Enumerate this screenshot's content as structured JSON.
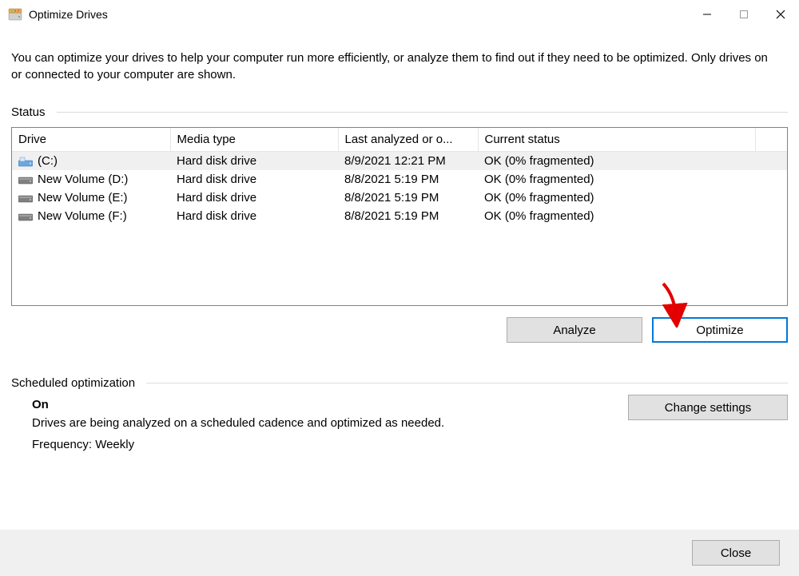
{
  "window": {
    "title": "Optimize Drives"
  },
  "description": "You can optimize your drives to help your computer run more efficiently, or analyze them to find out if they need to be optimized. Only drives on or connected to your computer are shown.",
  "status_label": "Status",
  "columns": {
    "drive": "Drive",
    "media": "Media type",
    "last": "Last analyzed or o...",
    "current": "Current status"
  },
  "drives": [
    {
      "name": "(C:)",
      "media": "Hard disk drive",
      "last": "8/9/2021 12:21 PM",
      "status": "OK (0% fragmented)",
      "icon": "system"
    },
    {
      "name": "New Volume (D:)",
      "media": "Hard disk drive",
      "last": "8/8/2021 5:19 PM",
      "status": "OK (0% fragmented)",
      "icon": "disk"
    },
    {
      "name": "New Volume (E:)",
      "media": "Hard disk drive",
      "last": "8/8/2021 5:19 PM",
      "status": "OK (0% fragmented)",
      "icon": "disk"
    },
    {
      "name": "New Volume (F:)",
      "media": "Hard disk drive",
      "last": "8/8/2021 5:19 PM",
      "status": "OK (0% fragmented)",
      "icon": "disk"
    }
  ],
  "buttons": {
    "analyze": "Analyze",
    "optimize": "Optimize",
    "change_settings": "Change settings",
    "close": "Close"
  },
  "scheduled": {
    "label": "Scheduled optimization",
    "on": "On",
    "desc": "Drives are being analyzed on a scheduled cadence and optimized as needed.",
    "frequency": "Frequency: Weekly"
  }
}
